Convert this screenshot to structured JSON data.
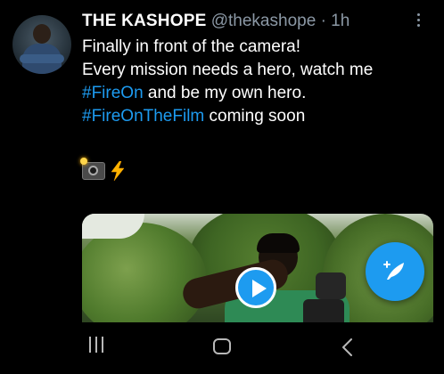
{
  "tweet": {
    "author_name": "THE KASHOPE",
    "handle": "@thekashope",
    "separator": "·",
    "time": "1h",
    "lines": {
      "line1": "Finally in front of the camera!",
      "line2": "Every mission needs a hero, watch me",
      "line3_tag": "#FireOn",
      "line3_rest": " and be my own hero.",
      "line4_tag": "#FireOnTheFilm",
      "line4_rest": " coming soon"
    },
    "emojis": [
      "camera-with-flash",
      "high-voltage"
    ]
  },
  "colors": {
    "background": "#000000",
    "accent": "#1d9bf0",
    "secondary_text": "#8b98a5"
  },
  "icons": {
    "more": "more-vertical-icon",
    "play": "play-icon",
    "compose": "compose-tweet-icon",
    "nav_recent": "recent-apps-icon",
    "nav_home": "home-icon",
    "nav_back": "back-icon"
  }
}
